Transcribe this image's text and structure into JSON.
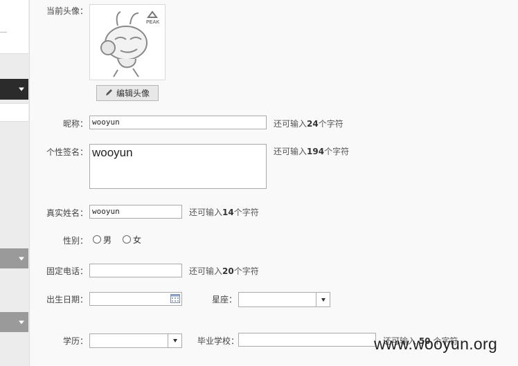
{
  "avatar": {
    "label": "当前头像：",
    "logo_text": "PEAK",
    "edit_button": "编辑头像"
  },
  "nickname": {
    "label": "昵称：",
    "value": "wooyun",
    "hint_prefix": "还可输入",
    "hint_count": "24",
    "hint_suffix": "个字符"
  },
  "signature": {
    "label": "个性签名：",
    "value": "wooyun",
    "hint_prefix": "还可输入",
    "hint_count": "194",
    "hint_suffix": "个字符"
  },
  "realname": {
    "label": "真实姓名：",
    "value": "wooyun",
    "hint_prefix": "还可输入",
    "hint_count": "14",
    "hint_suffix": "个字符"
  },
  "gender": {
    "label": "性别：",
    "options": [
      "男",
      "女"
    ]
  },
  "phone": {
    "label": "固定电话：",
    "value": "",
    "hint_prefix": "还可输入",
    "hint_count": "20",
    "hint_suffix": "个字符"
  },
  "birthday": {
    "label": "出生日期：",
    "value": ""
  },
  "zodiac": {
    "label": "星座：",
    "value": ""
  },
  "education": {
    "label": "学历：",
    "value": ""
  },
  "school": {
    "label": "毕业学校：",
    "value": "",
    "hint_prefix": "还可输入 ",
    "hint_count": "50",
    "hint_suffix": " 个字符"
  },
  "watermark": "www.wooyun.org"
}
